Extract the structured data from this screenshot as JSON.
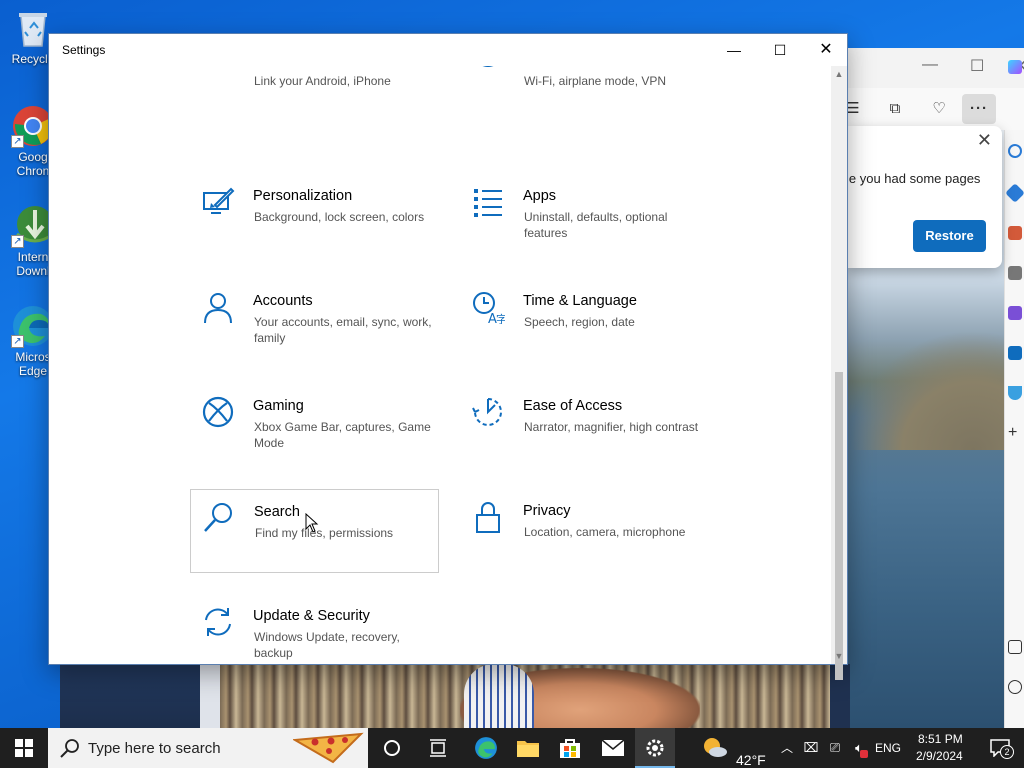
{
  "desktop": {
    "icons": [
      {
        "label": "Recycle",
        "icon": "recycle-bin-icon"
      },
      {
        "label": "Goog\nChron",
        "icon": "chrome-icon"
      },
      {
        "label": "Intern\nDownl",
        "icon": "idm-icon"
      },
      {
        "label": "Micros\nEdge",
        "icon": "edge-icon"
      }
    ]
  },
  "edge_window": {
    "restore_popup": {
      "message": "le you had some pages",
      "restore_label": "Restore"
    }
  },
  "settings": {
    "title": "Settings",
    "tiles": [
      {
        "key": "phone",
        "name": "",
        "desc": "Link your Android, iPhone",
        "icon": "phone-icon"
      },
      {
        "key": "network",
        "name": "",
        "desc": "Wi-Fi, airplane mode, VPN",
        "icon": "globe-icon"
      },
      {
        "key": "personalization",
        "name": "Personalization",
        "desc": "Background, lock screen, colors",
        "icon": "paint-display-icon"
      },
      {
        "key": "apps",
        "name": "Apps",
        "desc": "Uninstall, defaults, optional features",
        "icon": "apps-list-icon"
      },
      {
        "key": "accounts",
        "name": "Accounts",
        "desc": "Your accounts, email, sync, work, family",
        "icon": "person-icon"
      },
      {
        "key": "time",
        "name": "Time & Language",
        "desc": "Speech, region, date",
        "icon": "time-language-icon"
      },
      {
        "key": "gaming",
        "name": "Gaming",
        "desc": "Xbox Game Bar, captures, Game Mode",
        "icon": "xbox-icon"
      },
      {
        "key": "ease",
        "name": "Ease of Access",
        "desc": "Narrator, magnifier, high contrast",
        "icon": "ease-of-access-icon"
      },
      {
        "key": "search",
        "name": "Search",
        "desc": "Find my files, permissions",
        "icon": "search-icon"
      },
      {
        "key": "privacy",
        "name": "Privacy",
        "desc": "Location, camera, microphone",
        "icon": "lock-icon"
      },
      {
        "key": "update",
        "name": "Update & Security",
        "desc": "Windows Update, recovery, backup",
        "icon": "sync-arrows-icon"
      }
    ],
    "scroll_fraction": 0.5
  },
  "taskbar": {
    "search_placeholder": "Type here to search",
    "weather_temp": "42°F",
    "language": "ENG",
    "time": "8:51 PM",
    "date": "2/9/2024",
    "notification_count": "2"
  },
  "colors": {
    "accent": "#0067c0",
    "settings_icon": "#0f6cbd",
    "taskbar": "#1f1f1f",
    "desktop": "#1479e8"
  }
}
